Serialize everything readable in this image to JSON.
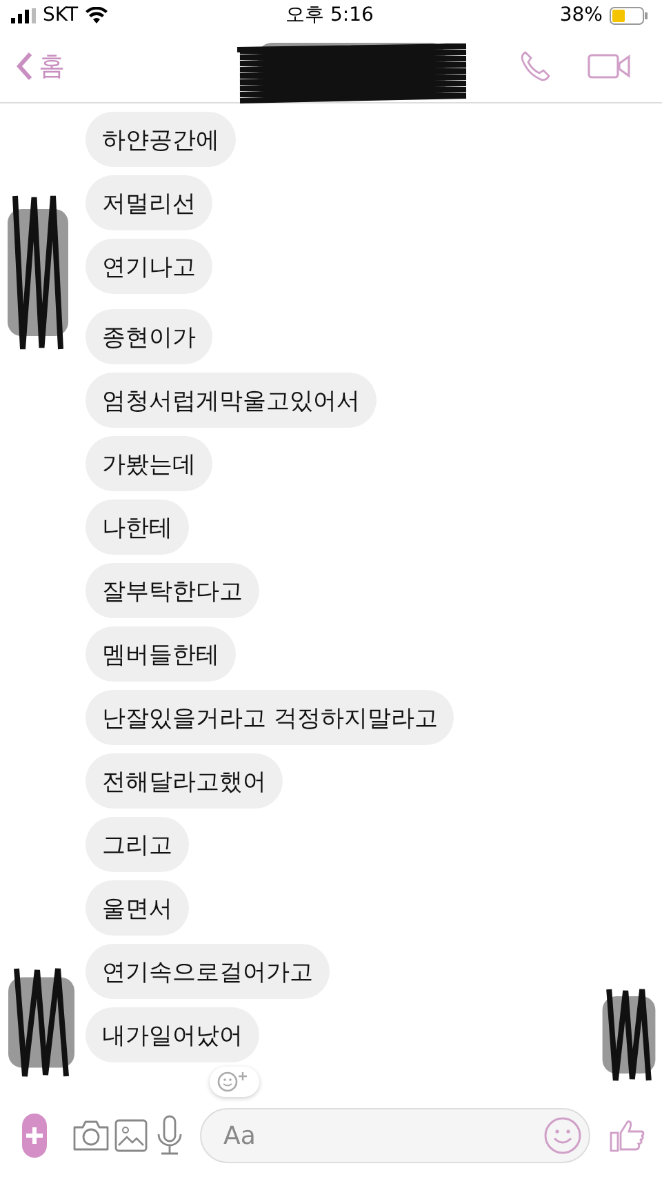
{
  "status_bar": {
    "carrier": "SKT",
    "time": "오후 5:16",
    "battery": "38%"
  },
  "header": {
    "back_label": "홈"
  },
  "groups": [
    {
      "messages": [
        "하얀공간에",
        "저멀리선",
        "연기나고"
      ]
    },
    {
      "messages": [
        "종현이가",
        "엄청서럽게막울고있어서",
        "가봤는데",
        "나한테",
        "잘부탁한다고",
        "멤버들한테",
        "난잘있을거라고 걱정하지말라고",
        "전해달라고했어",
        "그리고",
        "울면서",
        "연기속으로걸어가고",
        "내가일어났어"
      ]
    }
  ],
  "composer": {
    "placeholder": "Aa"
  }
}
